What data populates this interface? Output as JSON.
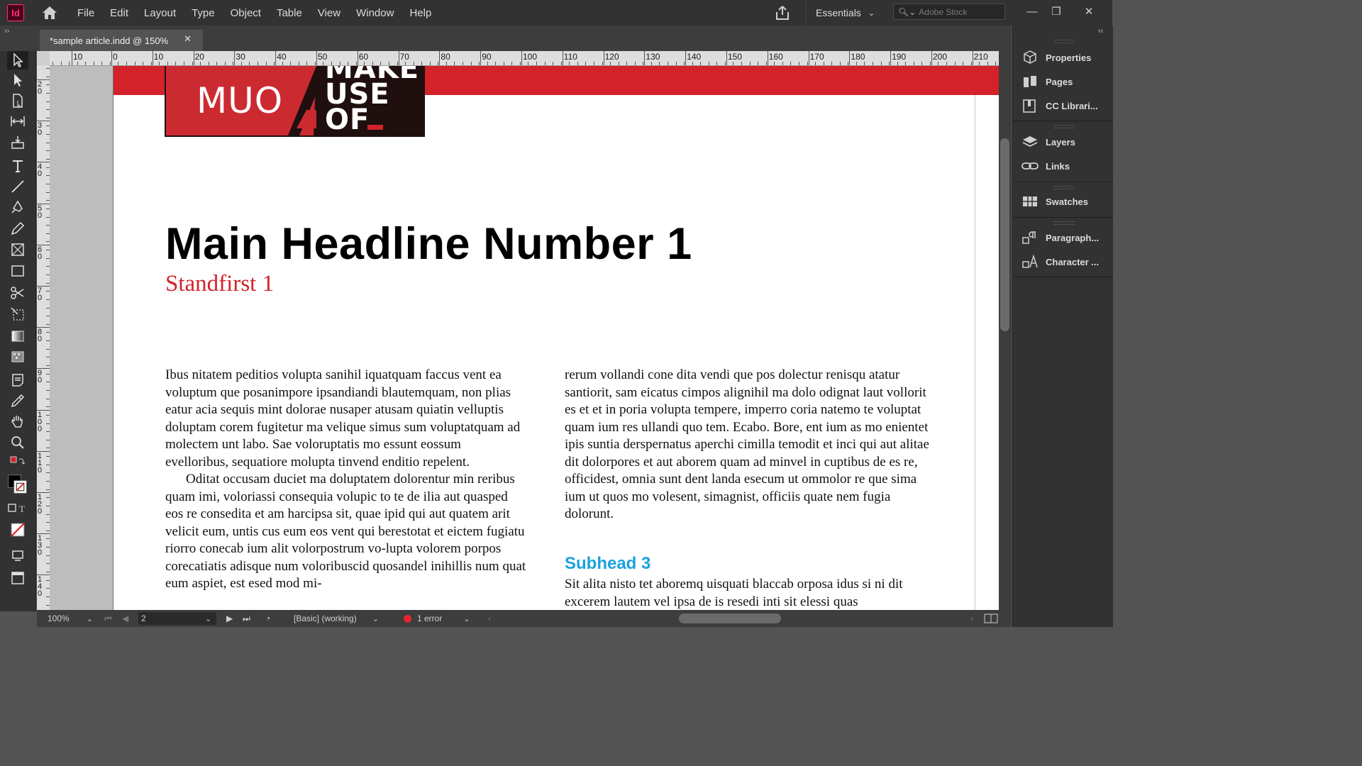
{
  "app": {
    "logo": "Id"
  },
  "menu": [
    "File",
    "Edit",
    "Layout",
    "Type",
    "Object",
    "Table",
    "View",
    "Window",
    "Help"
  ],
  "workspace": {
    "label": "Essentials"
  },
  "search": {
    "placeholder": "Adobe Stock"
  },
  "window_controls": {
    "minimize": "—",
    "restore": "❐",
    "close": "✕"
  },
  "tab": {
    "title": "*sample article.indd @ 150%",
    "close": "✕"
  },
  "ruler_h": [
    "10",
    "0",
    "10",
    "20",
    "30",
    "40",
    "50",
    "60",
    "70",
    "80",
    "90",
    "100",
    "110",
    "120",
    "130",
    "140",
    "150",
    "160",
    "170",
    "180",
    "190",
    "200",
    "210"
  ],
  "ruler_v": [
    "2 0",
    "3 0",
    "4 0",
    "5 0",
    "6 0",
    "7 0",
    "8 0",
    "9 0",
    "1 0 0",
    "1 1 0",
    "1 2 0",
    "1 3 0",
    "1 4 0"
  ],
  "logo": {
    "muo": "MUO",
    "line1": "MAKE",
    "line2": "USE",
    "line3": "OF"
  },
  "article": {
    "headline": "Main Headline Number 1",
    "standfirst": "Standfirst 1",
    "col_left_p1": "Ibus nitatem peditios volupta sanihil iquatquam faccus vent ea voluptum que posanimpore ipsandiandi blautemquam, non plias eatur acia sequis mint dolorae nusaper atusam quiatin velluptis doluptam corem fugitetur ma velique simus sum voluptatquam ad molectem unt labo. Sae voloruptatis mo essunt eossum evelloribus, sequatiore molupta tinvend enditio repelent.",
    "col_left_p2": "Oditat occusam duciet ma doluptatem dolorentur min reribus quam imi, voloriassi consequia volupic to te de ilia aut quasped eos re consedita et am harcipsa sit, quae ipid qui aut quatem arit velicit eum, untis cus eum eos vent qui berestotat et eictem fugiatu riorro conecab ium alit volorpostrum vo-lupta volorem porpos corecatiatis adisque num voloribuscid quosandel inihillis num quat eum aspiet, est esed mod mi-",
    "col_right_p1": "rerum vollandi cone dita vendi que pos dolectur renisqu atatur santiorit, sam eicatus cimpos alignihil ma dolo odignat laut vollorit es et et in poria volupta tempere, imperro coria natemo te voluptat quam ium res ullandi quo tem. Ecabo. Bore, ent ium as mo enientet ipis suntia derspernatus aperchi cimilla temodit et inci qui aut alitae dit dolorpores et aut aborem quam ad minvel in cuptibus de es re, officidest, omnia sunt dent landa esecum ut ommolor re que sima ium ut quos mo volesent, simagnist, officiis quate nem fugia dolorunt.",
    "subhead": "Subhead 3",
    "col_right_p2": "Sit alita nisto tet aboremq uisquati blaccab orposa idus si ni dit excerem lautem vel ipsa de is resedi inti sit elessi quas"
  },
  "status": {
    "zoom": "100%",
    "page": "2",
    "preflight_profile": "[Basic] (working)",
    "errors": "1 error"
  },
  "panels": [
    {
      "label": "Properties",
      "icon": "properties-icon"
    },
    {
      "label": "Pages",
      "icon": "pages-icon"
    },
    {
      "label": "CC Librari...",
      "icon": "cc-libraries-icon"
    },
    {
      "label": "Layers",
      "icon": "layers-icon"
    },
    {
      "label": "Links",
      "icon": "links-icon"
    },
    {
      "label": "Swatches",
      "icon": "swatches-icon"
    },
    {
      "label": "Paragraph...",
      "icon": "paragraph-icon"
    },
    {
      "label": "Character ...",
      "icon": "character-icon"
    }
  ],
  "colors": {
    "accent_red": "#d3222a",
    "subhead_blue": "#1ba2dd",
    "app_bg": "#323232"
  }
}
